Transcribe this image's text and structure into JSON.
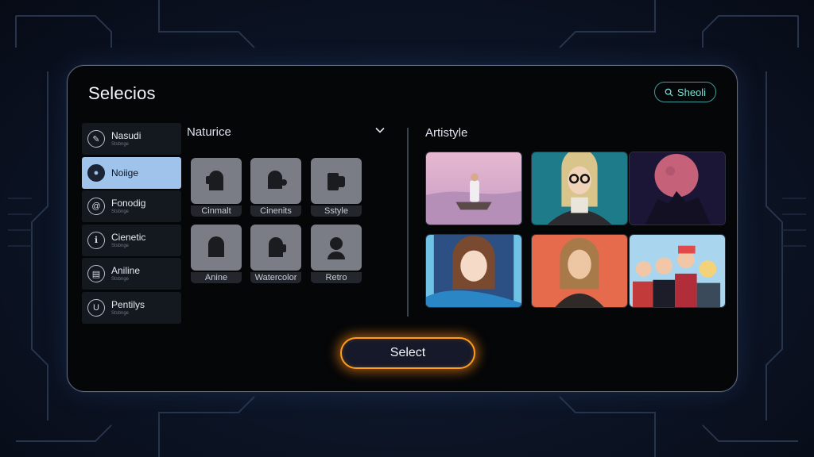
{
  "panel": {
    "title": "Selecios",
    "search": {
      "label": "Sheoli",
      "icon": "search-icon"
    }
  },
  "sidebar": {
    "items": [
      {
        "label": "Nasudi",
        "sub": "Stsbnge",
        "icon": "pen-icon",
        "glyph": "✎",
        "active": false
      },
      {
        "label": "Noiige",
        "sub": "",
        "icon": "person-icon",
        "glyph": "●",
        "active": true
      },
      {
        "label": "Fonodig",
        "sub": "Stsbnge",
        "icon": "at-icon",
        "glyph": "@",
        "active": false
      },
      {
        "label": "Cienetic",
        "sub": "Stsbnge",
        "icon": "info-icon",
        "glyph": "ℹ",
        "active": false
      },
      {
        "label": "Aniline",
        "sub": "Stsbnge",
        "icon": "document-icon",
        "glyph": "▤",
        "active": false
      },
      {
        "label": "Pentilys",
        "sub": "Stsbnge",
        "icon": "u-icon",
        "glyph": "U",
        "active": false
      }
    ]
  },
  "middle": {
    "title": "Naturice",
    "tiles": [
      {
        "label": "Cinmalt",
        "icon": "face-icon"
      },
      {
        "label": "Cinenits",
        "icon": "face-icon"
      },
      {
        "label": "Sstyle",
        "icon": "face-icon"
      },
      {
        "label": "Anine",
        "icon": "face-icon"
      },
      {
        "label": "Watercolor",
        "icon": "face-icon"
      },
      {
        "label": "Retro",
        "icon": "face-icon"
      }
    ]
  },
  "right": {
    "title": "Artistyle",
    "thumbnails": [
      {
        "name": "boat-scene-thumbnail"
      },
      {
        "name": "glasses-woman-thumbnail"
      },
      {
        "name": "moon-creature-thumbnail"
      },
      {
        "name": "anime-girl-thumbnail"
      },
      {
        "name": "portrait-woman-thumbnail"
      },
      {
        "name": "group-characters-thumbnail"
      }
    ]
  },
  "actions": {
    "select_label": "Select"
  },
  "colors": {
    "accent_orange": "#ff9d1e",
    "active_item": "#9fc3ea",
    "search_teal": "#3e9c9a"
  }
}
